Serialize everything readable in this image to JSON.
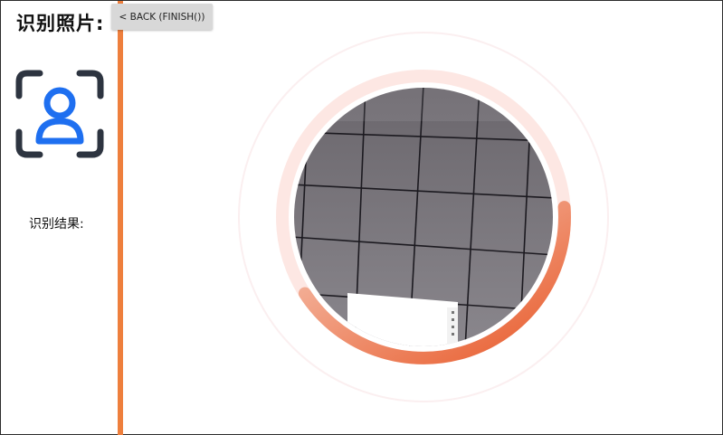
{
  "page": {
    "title": "识别照片:",
    "back_button_label": "< BACK (FINISH())",
    "result_label": "识别结果:"
  },
  "icons": {
    "face_scan": "face-scan-icon"
  },
  "progress": {
    "fraction": 0.42
  },
  "colors": {
    "divider": "#ee7f3d",
    "icon_frame": "#2d3440",
    "icon_person": "#1e6ff0",
    "progress_start": "#e85a2a",
    "progress_end": "#f6c9b8",
    "track": "#fde7e3"
  }
}
